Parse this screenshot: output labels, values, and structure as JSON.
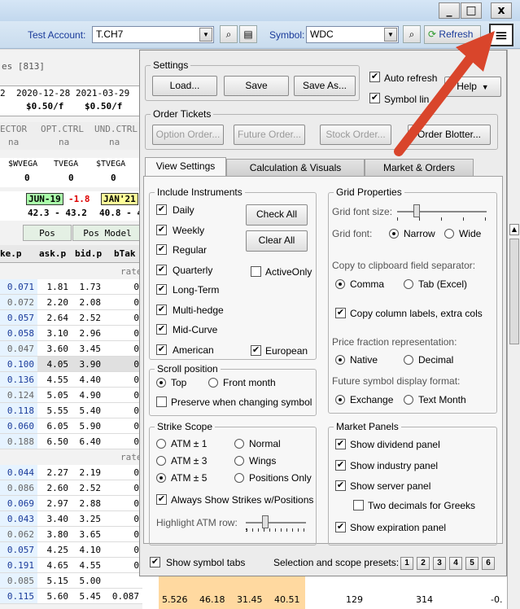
{
  "window": {
    "minimize": "_",
    "maximize": "□",
    "close": "x"
  },
  "toolbar": {
    "account_label": "Test Account:",
    "account_value": "T.CH7",
    "symbol_label": "Symbol:",
    "symbol_value": "WDC",
    "refresh_label": "Refresh",
    "menu_icon": "hamburger-menu-icon"
  },
  "left": {
    "header": "es [813]",
    "dates": [
      "2",
      "2020-12-28",
      "2021-03-29"
    ],
    "prices": [
      "$0.50/f",
      "$0.50/f"
    ],
    "ctrls": [
      "ECTOR",
      "OPT.CTRL",
      "UND.CTRL"
    ],
    "ctrl_vals": [
      "na",
      "na",
      "na"
    ],
    "greeks": [
      "$WVEGA",
      "TVEGA",
      "$TVEGA"
    ],
    "greek_vals": [
      "0",
      "0",
      "0"
    ],
    "exp1": "JUN-19",
    "exp1_chg": "-1.8",
    "exp2": "JAN'21",
    "range1": "42.3 - 43.2",
    "range2": "40.8 - 4",
    "tabs": [
      "Pos Greek",
      "Pos Model"
    ],
    "cols": [
      "ke.p",
      "ask.p",
      "bid.p",
      "bTak"
    ],
    "rate": "rate:",
    "rows1": [
      [
        "0.071",
        "1.81",
        "1.73",
        "0"
      ],
      [
        "0.072",
        "2.20",
        "2.08",
        "0"
      ],
      [
        "0.057",
        "2.64",
        "2.52",
        "0"
      ],
      [
        "0.058",
        "3.10",
        "2.96",
        "0"
      ],
      [
        "0.047",
        "3.60",
        "3.45",
        "0"
      ],
      [
        "0.100",
        "4.05",
        "3.90",
        "0"
      ],
      [
        "0.136",
        "4.55",
        "4.40",
        "0"
      ],
      [
        "0.124",
        "5.05",
        "4.90",
        "0"
      ],
      [
        "0.118",
        "5.55",
        "5.40",
        "0"
      ],
      [
        "0.060",
        "6.05",
        "5.90",
        "0"
      ],
      [
        "0.188",
        "6.50",
        "6.40",
        "0"
      ]
    ],
    "rows2": [
      [
        "0.044",
        "2.27",
        "2.19",
        "0"
      ],
      [
        "0.086",
        "2.60",
        "2.52",
        "0"
      ],
      [
        "0.069",
        "2.97",
        "2.88",
        "0"
      ],
      [
        "0.043",
        "3.40",
        "3.25",
        "0"
      ],
      [
        "0.062",
        "3.80",
        "3.65",
        "0"
      ],
      [
        "0.057",
        "4.25",
        "4.10",
        "0"
      ],
      [
        "0.191",
        "4.65",
        "4.55",
        "0"
      ],
      [
        "0.085",
        "5.15",
        "5.00",
        ""
      ],
      [
        "0.115",
        "5.60",
        "5.45",
        "0.087"
      ]
    ],
    "bottom_row": [
      "5.526",
      "46.18",
      "31.45",
      "40.51",
      "129",
      "314",
      "-0."
    ]
  },
  "panel": {
    "settings_title": "Settings",
    "load": "Load...",
    "save": "Save",
    "save_as": "Save As...",
    "auto_refresh": "Auto refresh",
    "symbol_link": "Symbol lin",
    "help": "Help",
    "order_title": "Order Tickets",
    "option_order": "Option Order...",
    "future_order": "Future Order...",
    "stock_order": "Stock Order...",
    "order_blotter": "Order Blotter...",
    "tabs": [
      "View Settings",
      "Calculation & Visuals",
      "Market & Orders"
    ],
    "include": {
      "title": "Include Instruments",
      "items": [
        "Daily",
        "Weekly",
        "Regular",
        "Quarterly",
        "Long-Term",
        "Multi-hedge",
        "Mid-Curve",
        "American"
      ],
      "check_all": "Check All",
      "clear_all": "Clear All",
      "active_only": "ActiveOnly",
      "european": "European"
    },
    "scroll": {
      "title": "Scroll position",
      "top": "Top",
      "front_month": "Front month",
      "preserve": "Preserve when changing symbol"
    },
    "strike": {
      "title": "Strike Scope",
      "atm1": "ATM ± 1",
      "normal": "Normal",
      "atm3": "ATM ± 3",
      "wings": "Wings",
      "atm5": "ATM ± 5",
      "positions_only": "Positions Only",
      "always_show": "Always Show Strikes w/Positions",
      "highlight": "Highlight ATM row:"
    },
    "grid": {
      "title": "Grid Properties",
      "font_size": "Grid font size:",
      "font": "Grid font:",
      "narrow": "Narrow",
      "wide": "Wide",
      "clip_sep": "Copy to clipboard field separator:",
      "comma": "Comma",
      "tab_excel": "Tab (Excel)",
      "copy_labels": "Copy column labels, extra cols",
      "price_frac": "Price fraction representation:",
      "native": "Native",
      "decimal": "Decimal",
      "future_fmt": "Future symbol display format:",
      "exchange": "Exchange",
      "text_month": "Text Month"
    },
    "market": {
      "title": "Market Panels",
      "items": [
        "Show dividend panel",
        "Show industry panel",
        "Show server panel"
      ],
      "two_decimals": "Two decimals for Greeks",
      "expiration": "Show expiration panel"
    },
    "show_symbol_tabs": "Show symbol tabs",
    "presets_label": "Selection and scope presets:",
    "presets": [
      "1",
      "2",
      "3",
      "4",
      "5",
      "6"
    ]
  },
  "colors": {
    "arrow": "#d9452b",
    "exp_green": "#aaffaa",
    "exp_yellow": "#ffff99"
  }
}
